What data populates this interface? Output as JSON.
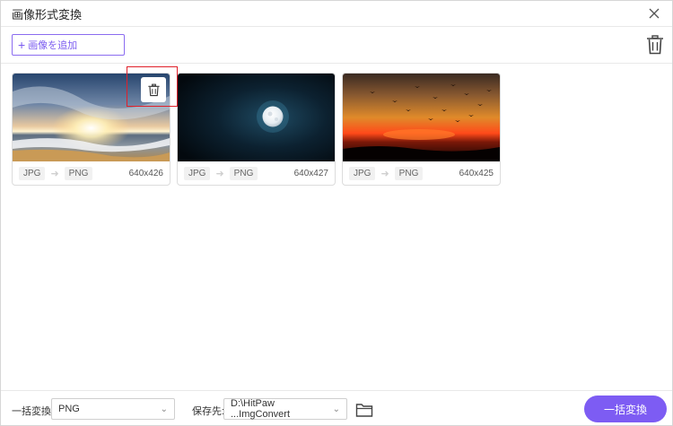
{
  "window": {
    "title": "画像形式変換",
    "close_icon": "close-icon"
  },
  "toolbar": {
    "add_label": "画像を追加",
    "add_icon": "+"
  },
  "cards": [
    {
      "from": "JPG",
      "to": "PNG",
      "dims": "640x426",
      "image": "beach-sunset"
    },
    {
      "from": "JPG",
      "to": "PNG",
      "dims": "640x427",
      "image": "full-moon"
    },
    {
      "from": "JPG",
      "to": "PNG",
      "dims": "640x425",
      "image": "sunset-birds"
    }
  ],
  "bottom": {
    "batch_label": "一括変換:",
    "batch_value": "PNG",
    "save_label": "保存先:",
    "save_value": "D:\\HitPaw ...ImgConvert",
    "convert_label": "一括変換"
  },
  "colors": {
    "accent": "#7d5cf3",
    "highlight": "#e0202a"
  }
}
